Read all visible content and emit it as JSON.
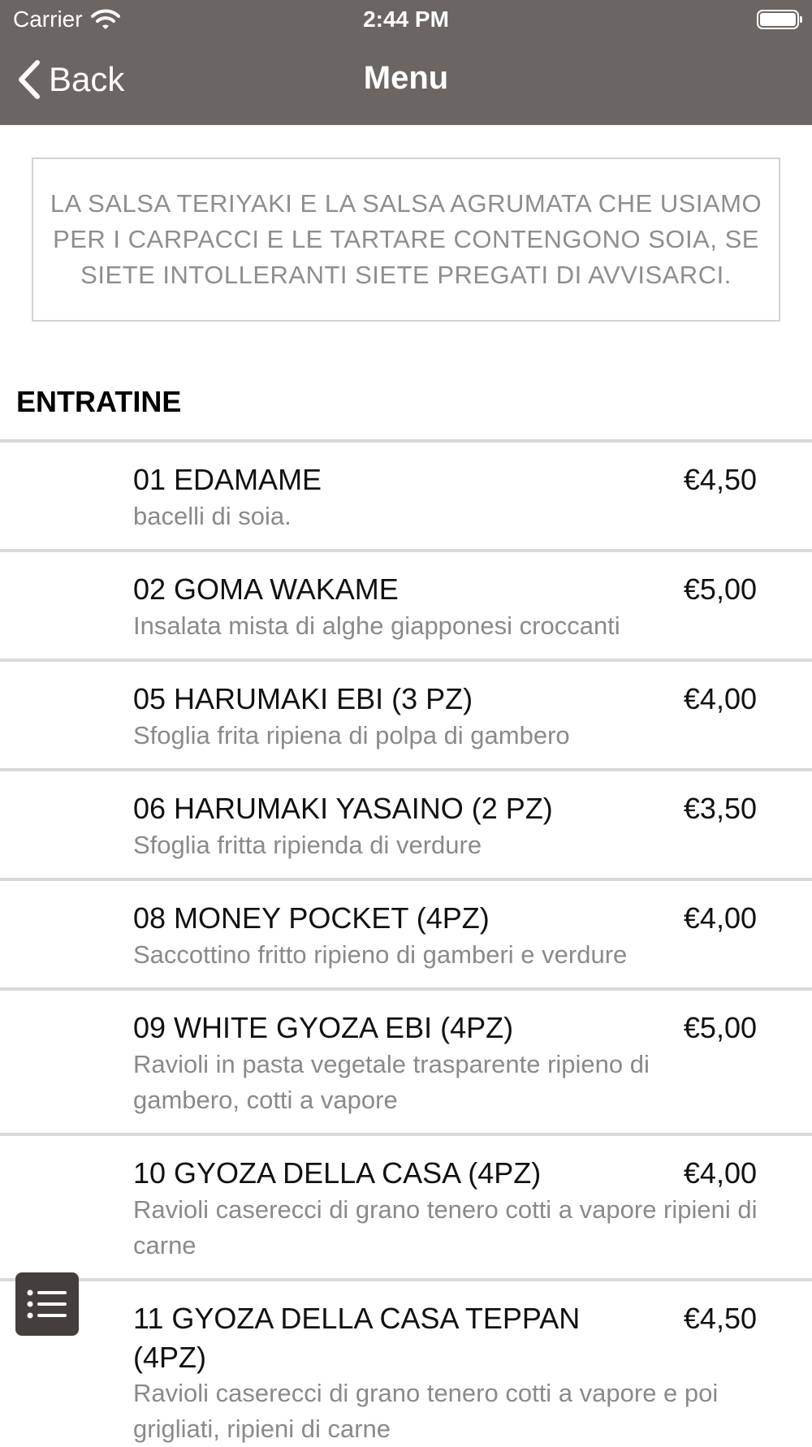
{
  "status": {
    "carrier": "Carrier",
    "time": "2:44 PM"
  },
  "nav": {
    "back_label": "Back",
    "title": "Menu"
  },
  "notice": "LA SALSA TERIYAKI E LA SALSA AGRUMATA CHE USIAMO PER I CARPACCI E LE TARTARE CONTENGONO SOIA, SE SIETE INTOLLERANTI SIETE PREGATI DI AVVISARCI.",
  "section": {
    "title": "ENTRATINE"
  },
  "items": [
    {
      "name": "01 EDAMAME",
      "price": "€4,50",
      "desc": "bacelli di soia."
    },
    {
      "name": "02 GOMA WAKAME",
      "price": "€5,00",
      "desc": "Insalata mista di alghe giapponesi croccanti"
    },
    {
      "name": "05 HARUMAKI EBI (3 PZ)",
      "price": "€4,00",
      "desc": "Sfoglia frita ripiena di polpa di gambero"
    },
    {
      "name": "06 HARUMAKI YASAINO (2 PZ)",
      "price": "€3,50",
      "desc": "Sfoglia fritta ripienda di verdure"
    },
    {
      "name": "08 MONEY POCKET (4PZ)",
      "price": "€4,00",
      "desc": "Saccottino fritto ripieno di gamberi e verdure"
    },
    {
      "name": "09 WHITE GYOZA EBI (4PZ)",
      "price": "€5,00",
      "desc": "Ravioli in pasta vegetale trasparente ripieno di gambero, cotti a vapore"
    },
    {
      "name": "10 GYOZA DELLA CASA (4PZ)",
      "price": "€4,00",
      "desc": "Ravioli caserecci di grano tenero cotti a vapore ripieni di carne"
    },
    {
      "name": "11 GYOZA DELLA CASA TEPPAN (4PZ)",
      "price": "€4,50",
      "desc": "Ravioli caserecci di grano tenero cotti a vapore e poi grigliati, ripieni di carne"
    }
  ],
  "icons": {
    "back": "chevron-left-icon",
    "wifi": "wifi-icon",
    "battery": "battery-icon",
    "menu": "list-icon"
  },
  "colors": {
    "nav_background": "#6b6661",
    "fab_background": "#443f3c",
    "separator": "#d9d9d9",
    "muted_text": "#8a8a8a"
  }
}
